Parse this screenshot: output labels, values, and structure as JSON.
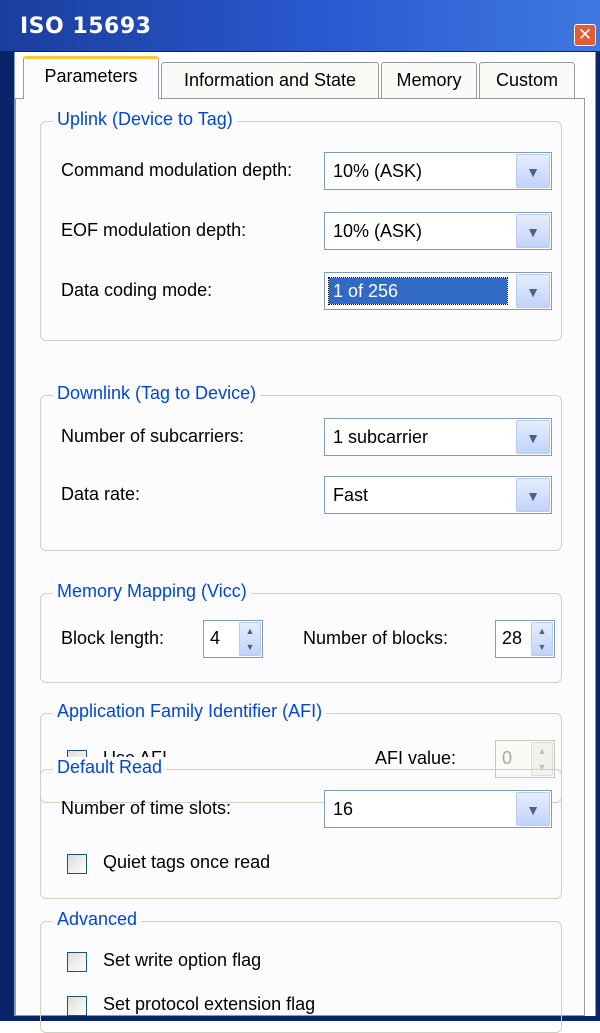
{
  "window": {
    "title": "ISO 15693"
  },
  "tabs": [
    "Parameters",
    "Information and State",
    "Memory",
    "Custom"
  ],
  "uplink": {
    "title": "Uplink (Device to Tag)",
    "cmd_label": "Command modulation depth:",
    "cmd_value": "10% (ASK)",
    "eof_label": "EOF modulation depth:",
    "eof_value": "10% (ASK)",
    "coding_label": "Data coding mode:",
    "coding_value": "1 of 256"
  },
  "downlink": {
    "title": "Downlink (Tag to Device)",
    "subcarriers_label": "Number of subcarriers:",
    "subcarriers_value": "1 subcarrier",
    "rate_label": "Data rate:",
    "rate_value": "Fast"
  },
  "memory": {
    "title": "Memory Mapping (Vicc)",
    "block_length_label": "Block length:",
    "block_length_value": "4",
    "num_blocks_label": "Number of blocks:",
    "num_blocks_value": "28"
  },
  "afi": {
    "title": "Application Family Identifier (AFI)",
    "use_label": "Use AFI",
    "use_checked": false,
    "value_label": "AFI value:",
    "value": "0"
  },
  "default_read": {
    "title": "Default Read",
    "slots_label": "Number of time slots:",
    "slots_value": "16",
    "quiet_label": "Quiet tags once read",
    "quiet_checked": false
  },
  "advanced": {
    "title": "Advanced",
    "write_label": "Set write option flag",
    "write_checked": false,
    "protocol_label": "Set protocol extension flag",
    "protocol_checked": false
  },
  "colors": {
    "titlebar": "#2a5ad0",
    "group_title": "#0046d5",
    "selection": "#316ac5",
    "close_button": "#e55b35"
  },
  "icons": {
    "close": "close-icon",
    "dropdown": "chevron-down-icon",
    "spin_up": "arrow-up-icon",
    "spin_down": "arrow-down-icon"
  }
}
